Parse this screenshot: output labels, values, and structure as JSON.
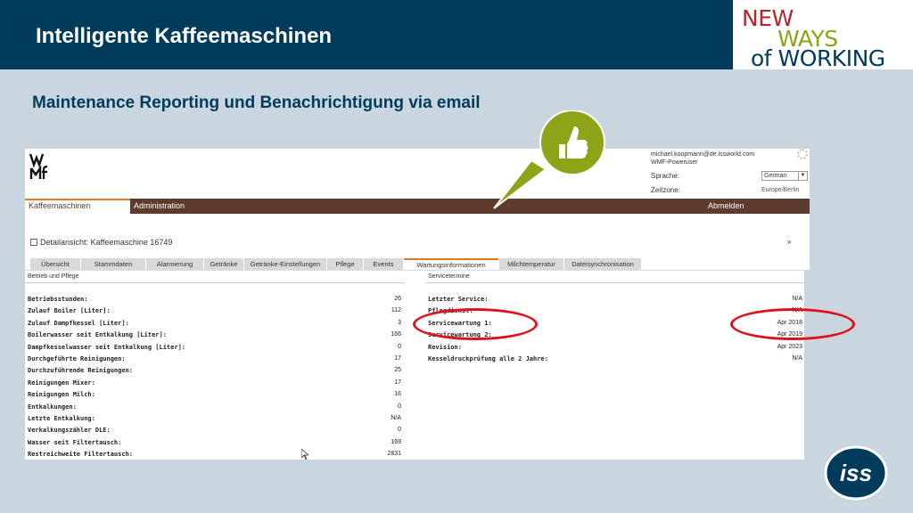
{
  "slide": {
    "title": "Intelligente Kaffeemaschinen",
    "subtitle": "Maintenance Reporting und Benachrichtigung via email",
    "nwow": {
      "line1": "NEW",
      "line2": "WAYS",
      "line3": "of WORKING"
    },
    "iss_logo_text": "iss"
  },
  "app": {
    "logo_text": "WMF",
    "user": {
      "email": "michael.koopmann@de.issworld.com",
      "role": "WMF-Poweruser",
      "language_label": "Sprache:",
      "language_value": "German",
      "timezone_label": "Zeitzone:",
      "timezone_value": "Europe/Berlin"
    },
    "nav": {
      "items": [
        "Kaffeemaschinen",
        "Administration"
      ],
      "logout": "Abmelden"
    },
    "detail_title": "Detailansicht: Kaffeemaschine 16749",
    "tabs": [
      "Übersicht",
      "Stammdaten",
      "Alarmierung",
      "Getränke",
      "Getränke-Einstellungen",
      "Pflege",
      "Events",
      "Wartungsinformationen",
      "Milchtemperatur",
      "Dateisynchronisation"
    ],
    "active_tab": "Wartungsinformationen",
    "betrieb": {
      "title": "Betrieb und Pflege",
      "rows": [
        {
          "label": "Betriebsstunden:",
          "value": "26"
        },
        {
          "label": "Zulauf Boiler [Liter]:",
          "value": "112"
        },
        {
          "label": "Zulauf Dampfkessel [Liter]:",
          "value": "3"
        },
        {
          "label": "Boilerwasser seit Entkalkung [Liter]:",
          "value": "166"
        },
        {
          "label": "Dampfkesselwasser seit Entkalkung [Liter]:",
          "value": "0"
        },
        {
          "label": "Durchgeführte Reinigungen:",
          "value": "17"
        },
        {
          "label": "Durchzuführende Reinigungen:",
          "value": "25"
        },
        {
          "label": "Reinigungen Mixer:",
          "value": "17"
        },
        {
          "label": "Reinigungen Milch:",
          "value": "16"
        },
        {
          "label": "Entkalkungen:",
          "value": "0"
        },
        {
          "label": "Letzte Entkalkung:",
          "value": "N/A"
        },
        {
          "label": "Verkalkungszähler DLE:",
          "value": "0"
        },
        {
          "label": "Wasser seit Filtertausch:",
          "value": "169"
        },
        {
          "label": "Restreichweite Filtertausch:",
          "value": "2831"
        }
      ]
    },
    "service": {
      "title": "Servicetermine",
      "rows": [
        {
          "label": "Letzter Service:",
          "value": "N/A"
        },
        {
          "label": "Pflegdienst:",
          "value": "N/A"
        },
        {
          "label": "Servicewartung 1:",
          "value": "Apr 2018"
        },
        {
          "label": "Servicewartung 2:",
          "value": "Apr 2019"
        },
        {
          "label": "Revision:",
          "value": "Apr 2023"
        },
        {
          "label": "Kesseldruckprüfung alle 2 Jahre:",
          "value": "N/A"
        }
      ]
    }
  },
  "colors": {
    "header_blue": "#003b5c",
    "nav_brown": "#5d3c2d",
    "accent_orange": "#e07a1e",
    "highlight_red": "#e0101a",
    "thumb_green": "#8fa318"
  }
}
